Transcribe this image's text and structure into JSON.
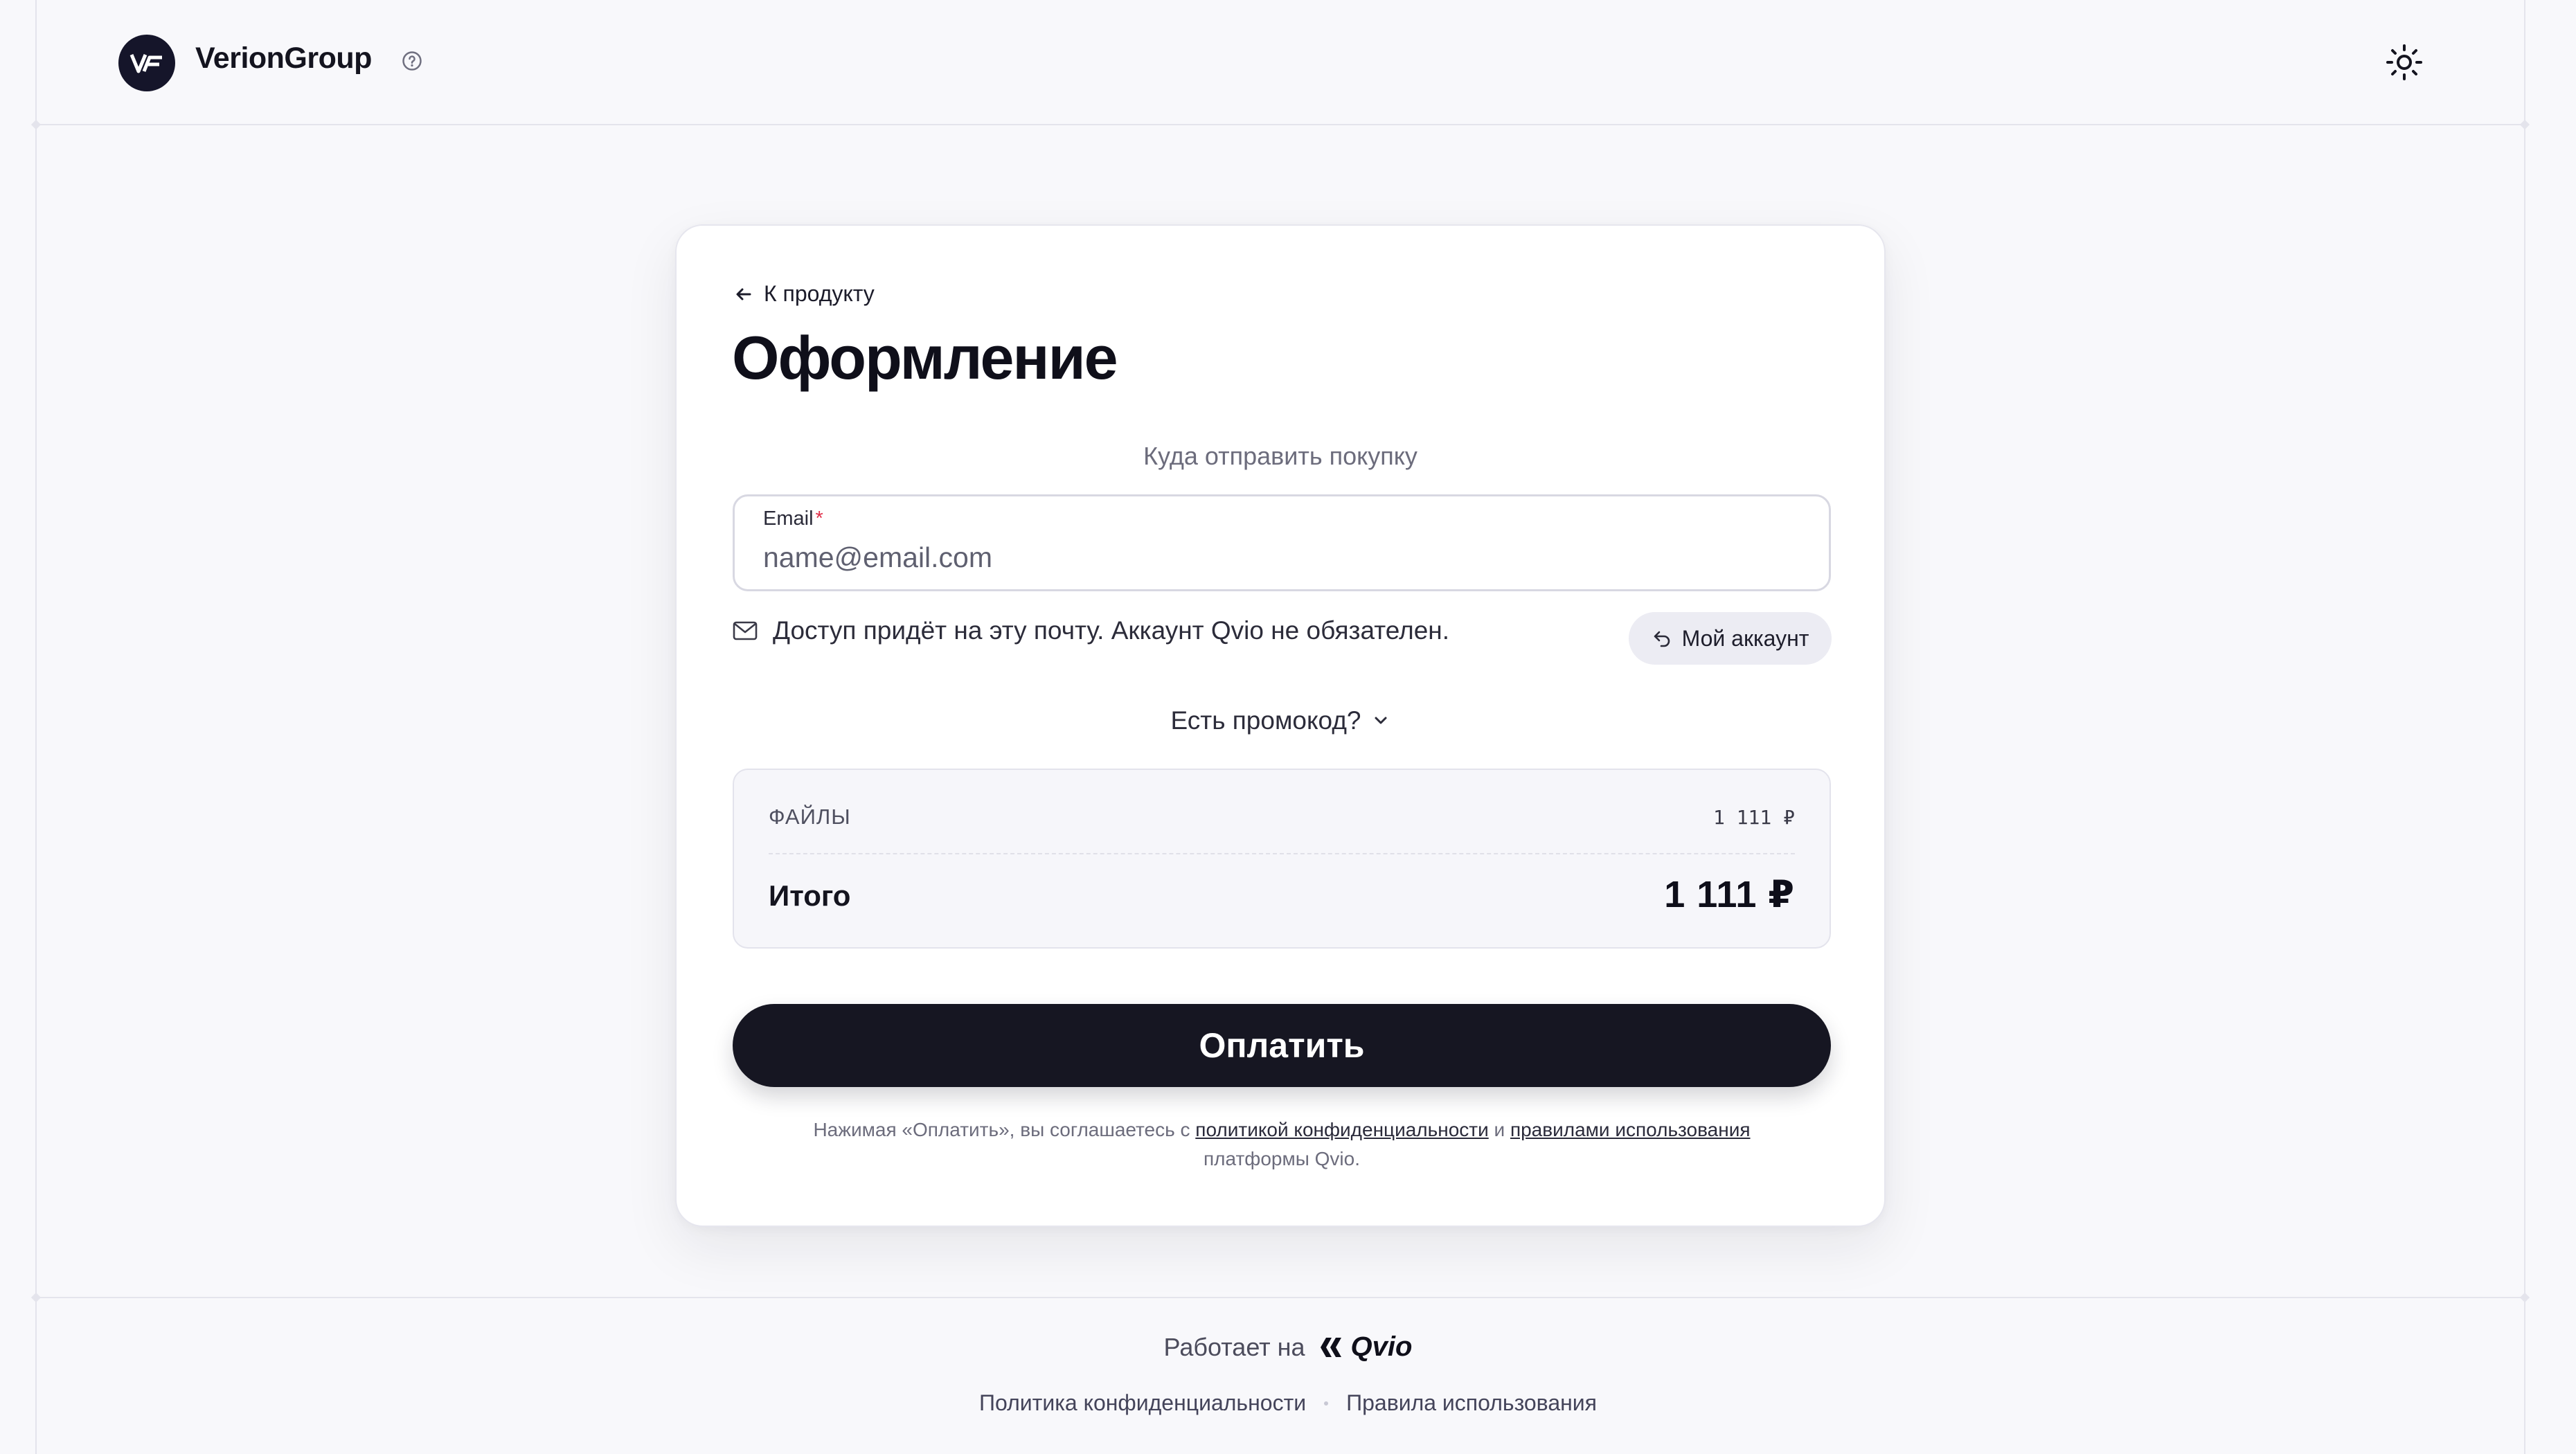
{
  "header": {
    "brand": "VerionGroup",
    "logo_icon": "brand-logo-icon",
    "help_icon": "help-circle-icon",
    "theme_icon": "sun-icon"
  },
  "checkout": {
    "back_link": "К продукту",
    "title": "Оформление",
    "section_label": "Куда отправить покупку",
    "email": {
      "label": "Email",
      "required_mark": "*",
      "placeholder": "name@email.com",
      "value": ""
    },
    "hint": "Доступ придёт на эту почту. Аккаунт Qvio не обязателен.",
    "account_button": "Мой аккаунт",
    "promo_toggle": "Есть промокод?",
    "summary": {
      "item_label": "ФАЙЛЫ",
      "item_value": "1 111 ₽",
      "total_label": "Итого",
      "total_value": "1 111 ₽"
    },
    "pay_button": "Оплатить",
    "legal": {
      "prefix": "Нажимая «Оплатить», вы соглашаетесь с",
      "privacy_link": "политикой конфиденциальности",
      "and": "и",
      "terms_link": "правилами использования",
      "suffix": "платформы Qvio."
    }
  },
  "footer": {
    "powered_by": "Работает на",
    "platform": "Qvio",
    "privacy": "Политика конфиденциальности",
    "terms": "Правила использования"
  },
  "colors": {
    "background": "#f8f8fb",
    "card": "#ffffff",
    "primary_button": "#161622",
    "required": "#e0304a"
  }
}
